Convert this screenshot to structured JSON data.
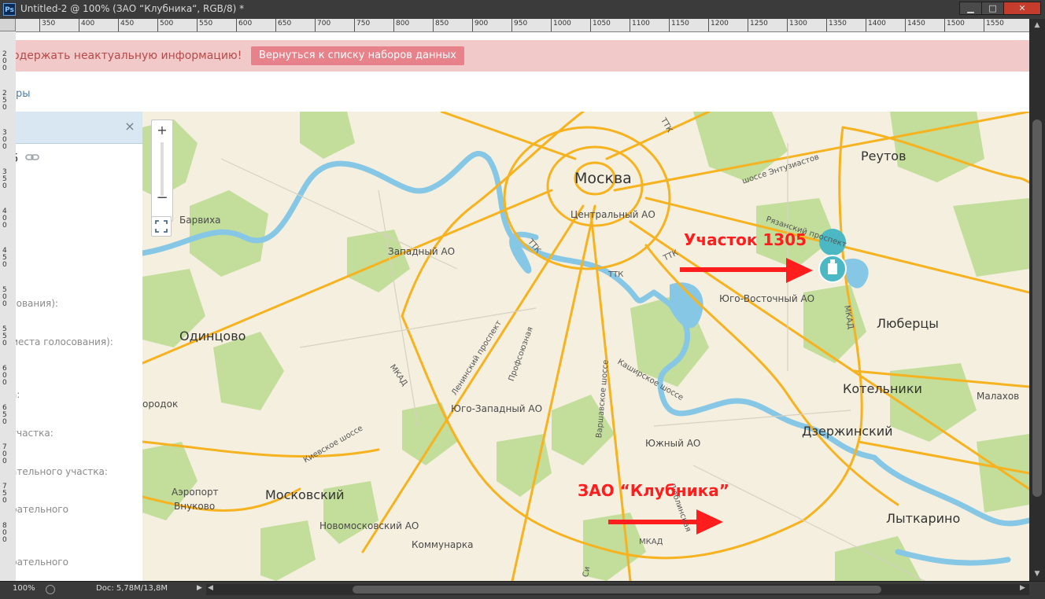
{
  "window": {
    "title": "Untitled-2 @ 100% (ЗАО “Клубника“, RGB/8) *",
    "app_icon": "Ps",
    "controls": {
      "minimize": "▁",
      "maximize": "□",
      "close": "✕"
    }
  },
  "rulers": {
    "horizontal_ticks": [
      "350",
      "400",
      "450",
      "500",
      "550",
      "600",
      "650",
      "700",
      "750",
      "800",
      "850",
      "900",
      "950",
      "1000",
      "1050",
      "1100",
      "1150",
      "1200",
      "1250",
      "1300",
      "1350",
      "1400",
      "1450",
      "1500",
      "1550"
    ],
    "vertical_ticks": [
      "200",
      "250",
      "300",
      "350",
      "400",
      "450",
      "500",
      "550",
      "600",
      "650",
      "700",
      "750",
      "800"
    ]
  },
  "page": {
    "alert_text": "одержать неактуальную информацию!",
    "back_button": "Вернуться к списку наборов данных",
    "tab_fragment": "ры",
    "panel": {
      "close": "×",
      "number_fragment": "5",
      "labels": [
        "сования):",
        "места голосования):",
        "а:",
        "участка:",
        "ательного участка:",
        "рательного",
        "рательного"
      ]
    }
  },
  "map": {
    "controls": {
      "zoom_in": "+",
      "zoom_out": "−"
    },
    "labels": {
      "moscow": "Москва",
      "central": "Центральный АО",
      "reutov": "Реутов",
      "barvikha": "Барвиха",
      "zapadny": "Западный АО",
      "entuziastov": "шоссе Энтузиастов",
      "ryazansky": "Рязанский проспект",
      "ttk1": "ТТК",
      "ttk2": "ТТК",
      "ttk3": "ТТК",
      "ttk4": "ТТК",
      "yugo_vostochny": "Юго-Восточный АО",
      "mkad_east": "МКАД",
      "lyubertsy": "Люберцы",
      "odintsovo": "Одинцово",
      "leninsky": "Ленинский проспект",
      "profsoyuznaya": "Профсоюзная",
      "varshavskoe": "Варшавское шоссе",
      "kashirskoe": "Каширское шоссе",
      "mkad_west": "МКАД",
      "kotelniki": "Котельники",
      "malakhovka": "Малахов",
      "gorodok": "ородок",
      "yugo_zapadny": "Юго-Западный АО",
      "dzerzhinsky": "Дзержинский",
      "yuzhny": "Южный АО",
      "kievskoe": "Киевское шоссе",
      "airport": "Аэропорт",
      "vnukovo": "Внуково",
      "moskovsky": "Московский",
      "lublinskaya": "Люблинская",
      "lytkarino": "Лыткарино",
      "novomoskovsky": "Новомосковский АО",
      "kommunarka": "Коммунарка",
      "mkad_south": "МКАД",
      "si": "Си"
    },
    "annotations": {
      "uchastok": "Участок 1305",
      "zao": "ЗАО “Клубника”"
    },
    "colors": {
      "roads": "#f6b21f",
      "water": "#86c7e6",
      "forest": "#c3dd9a",
      "annotation": "#ff1d1d",
      "marker": "#4bb8c4"
    }
  },
  "status": {
    "zoom": "100%",
    "doc": "Doc: 5,78M/13,8M"
  }
}
